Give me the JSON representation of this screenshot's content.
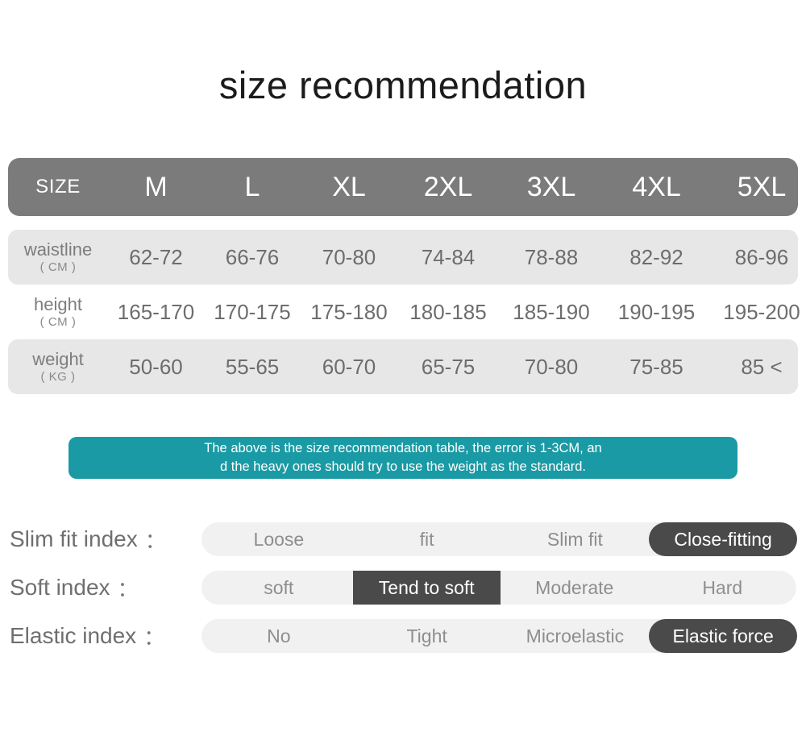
{
  "title": "size recommendation",
  "size_table": {
    "header": {
      "label": "SIZE",
      "sizes": [
        "M",
        "L",
        "XL",
        "2XL",
        "3XL",
        "4XL",
        "5XL"
      ]
    },
    "rows": [
      {
        "label": "waistline",
        "unit": "( CM )",
        "values": [
          "62-72",
          "66-76",
          "70-80",
          "74-84",
          "78-88",
          "82-92",
          "86-96"
        ]
      },
      {
        "label": "height",
        "unit": "( CM )",
        "values": [
          "165-170",
          "170-175",
          "175-180",
          "180-185",
          "185-190",
          "190-195",
          "195-200"
        ]
      },
      {
        "label": "weight",
        "unit": "( KG )",
        "values": [
          "50-60",
          "55-65",
          "60-70",
          "65-75",
          "70-80",
          "75-85",
          "85 <"
        ]
      }
    ]
  },
  "note": {
    "line1": "The above is the size recommendation table, the error is 1-3CM, an",
    "line2": "d the heavy ones should try to use the weight as the standard."
  },
  "indices": [
    {
      "label": "Slim fit index",
      "colon": "：",
      "options": [
        "Loose",
        "fit",
        "Slim fit",
        "Close-fitting"
      ],
      "selected": "Close-fitting"
    },
    {
      "label": "Soft index",
      "colon": "：",
      "options": [
        "soft",
        "Tend to soft",
        "Moderate",
        "Hard"
      ],
      "selected": "Tend to soft"
    },
    {
      "label": "Elastic index",
      "colon": "：",
      "options": [
        "No",
        "Tight",
        "Microelastic",
        "Elastic force"
      ],
      "selected": "Elastic force"
    }
  ],
  "colors": {
    "header_gray": "#7b7b7b",
    "row_gray": "#e7e7e7",
    "teal": "#1a9aa4",
    "highlight": "#4a4a4a",
    "track_gray": "#f1f1f1",
    "text_gray": "#6d6d6d"
  }
}
